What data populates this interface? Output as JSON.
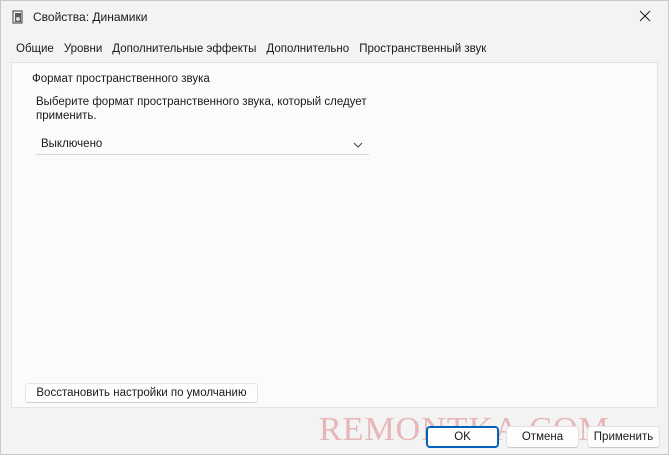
{
  "window": {
    "title": "Свойства: Динамики"
  },
  "tabs": [
    {
      "label": "Общие"
    },
    {
      "label": "Уровни"
    },
    {
      "label": "Дополнительные эффекты"
    },
    {
      "label": "Дополнительно"
    },
    {
      "label": "Пространственный звук",
      "active": true
    }
  ],
  "spatial": {
    "group_title": "Формат пространственного звука",
    "description": "Выберите формат пространственного звука, который следует применить.",
    "format_value": "Выключено"
  },
  "restore_button": "Восстановить настройки по умолчанию",
  "watermark": "REMONTKA.COM",
  "buttons": {
    "ok": "OK",
    "cancel": "Отмена",
    "apply": "Применить"
  }
}
